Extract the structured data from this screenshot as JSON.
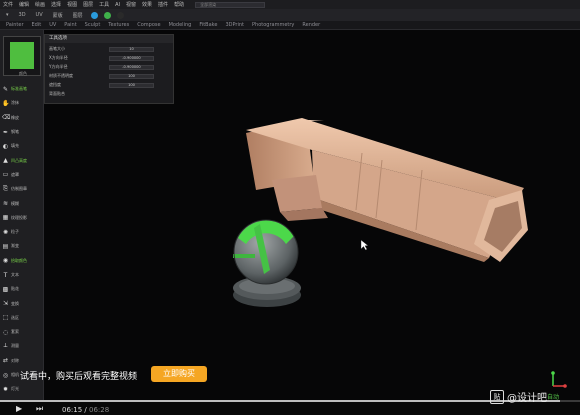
{
  "menubar": {
    "items": [
      "文件",
      "编辑",
      "绘画",
      "选择",
      "视图",
      "图层",
      "工具",
      "AI",
      "视窗",
      "效果",
      "插件",
      "帮助"
    ],
    "search_placeholder": "全部渲染"
  },
  "toolbar": {
    "items": [
      "▾",
      "3D",
      "UV",
      "蒙版",
      "图层"
    ],
    "color_dots": [
      "#2a9bdc",
      "#3fb04a",
      "#2a2a2a"
    ]
  },
  "tabs": [
    "Painter",
    "Edit",
    "UV",
    "Paint",
    "Sculpt",
    "Textures",
    "Compose",
    "Modeling",
    "FitBake",
    "3DPrint",
    "Photogrammetry",
    "Render"
  ],
  "sidebar": {
    "swatch_color": "#4fbe3f",
    "swatch_label": "颜色",
    "tools": [
      {
        "icon": "brush-icon",
        "glyph": "✎",
        "label": "标准画笔",
        "green": true
      },
      {
        "icon": "smudge-icon",
        "glyph": "✋",
        "label": "涂抹",
        "green": false
      },
      {
        "icon": "eraser-icon",
        "glyph": "⌫",
        "label": "橡皮",
        "green": false
      },
      {
        "icon": "pen-icon",
        "glyph": "✒",
        "label": "钢笔",
        "green": false
      },
      {
        "icon": "fill-icon",
        "glyph": "◐",
        "label": "填充",
        "green": false
      },
      {
        "icon": "height-icon",
        "glyph": "▲",
        "label": "凹凸高度",
        "green": true
      },
      {
        "icon": "mask-icon",
        "glyph": "▭",
        "label": "遮罩",
        "green": false
      },
      {
        "icon": "clone-icon",
        "glyph": "⎘",
        "label": "仿制图章",
        "green": false
      },
      {
        "icon": "blur-icon",
        "glyph": "≋",
        "label": "模糊",
        "green": false
      },
      {
        "icon": "texture-icon",
        "glyph": "▦",
        "label": "纹理投影",
        "green": false
      },
      {
        "icon": "particle-icon",
        "glyph": "✺",
        "label": "粒子",
        "green": false
      },
      {
        "icon": "gradient-icon",
        "glyph": "▤",
        "label": "渐变",
        "green": false
      },
      {
        "icon": "color-pick-icon",
        "glyph": "◉",
        "label": "拾取颜色",
        "green": true
      },
      {
        "icon": "text-icon",
        "glyph": "T",
        "label": "文本",
        "green": false
      },
      {
        "icon": "decal-icon",
        "glyph": "▩",
        "label": "贴花",
        "green": false
      },
      {
        "icon": "transform-icon",
        "glyph": "⇲",
        "label": "变换",
        "green": false
      },
      {
        "icon": "select-icon",
        "glyph": "⬚",
        "label": "选区",
        "green": false
      },
      {
        "icon": "lasso-icon",
        "glyph": "◌",
        "label": "套索",
        "green": false
      },
      {
        "icon": "measure-icon",
        "glyph": "⟂",
        "label": "测量",
        "green": false
      },
      {
        "icon": "mirror-icon",
        "glyph": "⇄",
        "label": "对称",
        "green": false
      },
      {
        "icon": "camera-icon",
        "glyph": "◎",
        "label": "相机",
        "green": false
      },
      {
        "icon": "light-icon",
        "glyph": "✹",
        "label": "灯光",
        "green": false
      },
      {
        "icon": "layer-icon",
        "glyph": "☰",
        "label": "图层",
        "green": false
      },
      {
        "icon": "settings-icon",
        "glyph": "⚙",
        "label": "设置",
        "green": false
      }
    ]
  },
  "props_panel": {
    "title": "工具选项",
    "rows": [
      {
        "label": "画笔大小",
        "value": "10"
      },
      {
        "label": "X方向半径",
        "value": "-0.900000"
      },
      {
        "label": "Y方向半径",
        "value": "-0.900000"
      },
      {
        "label": "材质不透明度",
        "value": "100"
      },
      {
        "label": "遮挡度",
        "value": "100"
      },
      {
        "label": "背面贴合",
        "value": ""
      }
    ]
  },
  "overlay": {
    "trial_text": "试看中，购买后观看完整视频",
    "buy_button": "立即购买"
  },
  "gizmo": {
    "label": "自动"
  },
  "video": {
    "current_time": "06:15",
    "separator": " / ",
    "total_time": "06:28",
    "progress": 0.966
  },
  "watermark": {
    "badge": "贴",
    "text": "@设计吧"
  }
}
